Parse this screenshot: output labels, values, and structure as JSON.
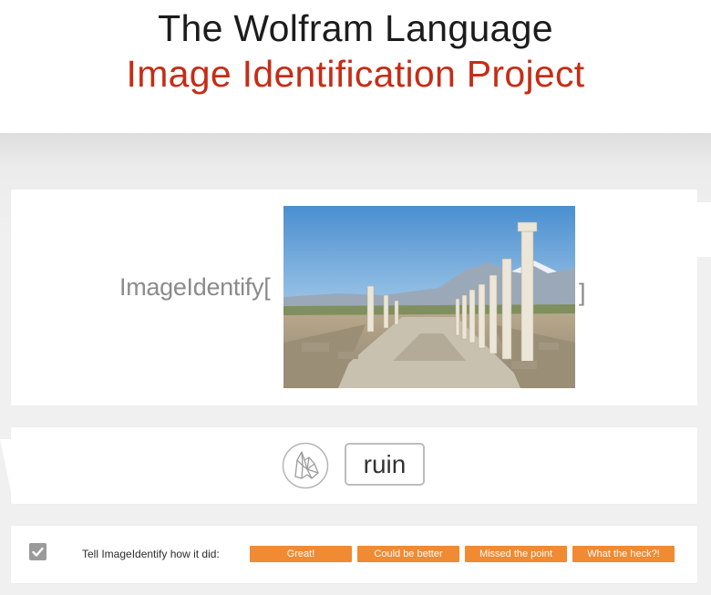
{
  "header": {
    "title_line1": "The Wolfram Language",
    "title_line2": "Image Identification Project"
  },
  "input": {
    "function_prefix": "ImageIdentify[",
    "function_suffix": "]",
    "image_subject": "ancient colonnaded street ruins"
  },
  "result": {
    "icon": "wolf-icon",
    "label": "ruin"
  },
  "feedback": {
    "prompt": "Tell ImageIdentify how it did:",
    "checkbox_icon": "check-icon",
    "buttons": [
      "Great!",
      "Could be better",
      "Missed the point",
      "What the heck?!"
    ]
  },
  "colors": {
    "brand_red": "#c62d16",
    "button_orange": "#f08a33"
  }
}
